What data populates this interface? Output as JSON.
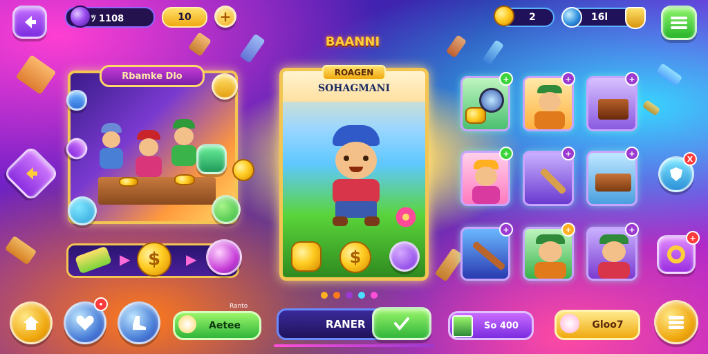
{
  "hud": {
    "left_currency_value": "ﾂ 1108",
    "gold_value": "10",
    "gems_count": "2",
    "score_value": "16l"
  },
  "left_panel": {
    "title": "Rbamke Dlo"
  },
  "center_card": {
    "header": "BAANNI",
    "title_top": "ROAGEN",
    "title_bottom": "SOHAGMANI",
    "pager_dots": 5,
    "active_dot": 3
  },
  "bottom_bar": {
    "small_label": "Ranto",
    "green_button": "Aetee",
    "center_button": "RANER",
    "purple_button": "So 400",
    "gold_button": "Gloo7"
  },
  "badges": {
    "heart_badge": "•",
    "right_top_badge": "X",
    "gear_badge": "+"
  },
  "icons": {
    "back": "arrow-left-icon",
    "menu": "hamburger-icon",
    "home": "home-icon",
    "heart": "heart-icon",
    "boot": "boot-icon",
    "shield": "shield-icon"
  },
  "colors": {
    "accent_green": "#3ad43a",
    "accent_gold": "#ffcc22",
    "accent_purple": "#8a3ae8",
    "accent_pink": "#ff4fd8"
  }
}
